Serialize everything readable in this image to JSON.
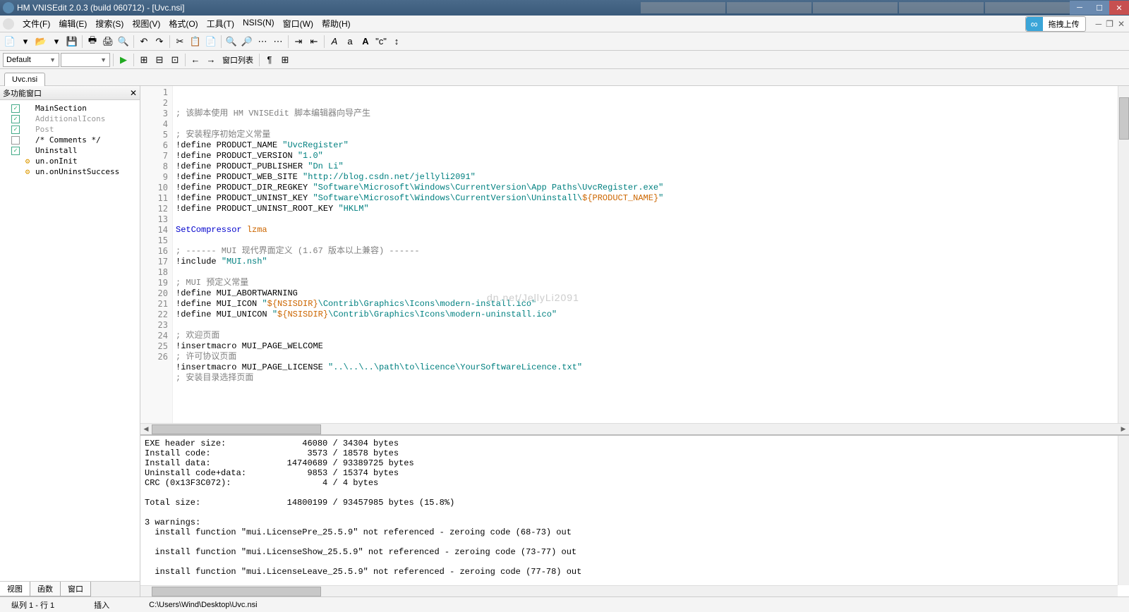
{
  "title": "HM VNISEdit 2.0.3 (build 060712) - [Uvc.nsi]",
  "menu": [
    "文件(F)",
    "编辑(E)",
    "搜索(S)",
    "视图(V)",
    "格式(O)",
    "工具(T)",
    "NSIS(N)",
    "窗口(W)",
    "帮助(H)"
  ],
  "upload_text": "拖拽上传",
  "combo1": "Default",
  "window_list_label": "窗口列表",
  "file_tab": "Uvc.nsi",
  "panel_title": "多功能窗口",
  "tree": [
    {
      "check": true,
      "icon": "□",
      "label": "MainSection",
      "gray": false
    },
    {
      "check": true,
      "icon": "□",
      "label": "AdditionalIcons",
      "gray": true
    },
    {
      "check": true,
      "icon": "□",
      "label": "Post",
      "gray": true
    },
    {
      "check": false,
      "icon": "□",
      "label": "/* Comments */",
      "gray": false
    },
    {
      "check": true,
      "icon": "□",
      "label": "Uninstall",
      "gray": false
    },
    {
      "check": false,
      "icon": "⚙",
      "label": "un.onInit",
      "gray": false
    },
    {
      "check": false,
      "icon": "⚙",
      "label": "un.onUninstSuccess",
      "gray": false
    }
  ],
  "bottom_tabs": [
    "视图",
    "函数",
    "窗口"
  ],
  "code_lines": [
    {
      "n": 1,
      "html": "<span class='kw-comment'>; 该脚本使用 HM VNISEdit 脚本编辑器向导产生</span>"
    },
    {
      "n": 2,
      "html": ""
    },
    {
      "n": 3,
      "html": "<span class='kw-comment'>; 安装程序初始定义常量</span>"
    },
    {
      "n": 4,
      "html": "<span class='kw-define'>!define</span> PRODUCT_NAME <span class='kw-string'>\"UvcRegister\"</span>"
    },
    {
      "n": 5,
      "html": "<span class='kw-define'>!define</span> PRODUCT_VERSION <span class='kw-string'>\"1.0\"</span>"
    },
    {
      "n": 6,
      "html": "<span class='kw-define'>!define</span> PRODUCT_PUBLISHER <span class='kw-string'>\"Dn Li\"</span>"
    },
    {
      "n": 7,
      "html": "<span class='kw-define'>!define</span> PRODUCT_WEB_SITE <span class='kw-string'>\"http://blog.csdn.net/jellyli2091\"</span>"
    },
    {
      "n": 8,
      "html": "<span class='kw-define'>!define</span> PRODUCT_DIR_REGKEY <span class='kw-string'>\"Software\\Microsoft\\Windows\\CurrentVersion\\App Paths\\UvcRegister.exe\"</span>"
    },
    {
      "n": 9,
      "html": "<span class='kw-define'>!define</span> PRODUCT_UNINST_KEY <span class='kw-string'>\"Software\\Microsoft\\Windows\\CurrentVersion\\Uninstall\\</span><span class='kw-var'>${PRODUCT_NAME}</span><span class='kw-string'>\"</span>"
    },
    {
      "n": 10,
      "html": "<span class='kw-define'>!define</span> PRODUCT_UNINST_ROOT_KEY <span class='kw-string'>\"HKLM\"</span>"
    },
    {
      "n": 11,
      "html": ""
    },
    {
      "n": 12,
      "html": "<span class='kw-cmd'>SetCompressor</span> <span class='kw-macro'>lzma</span>"
    },
    {
      "n": 13,
      "html": ""
    },
    {
      "n": 14,
      "html": "<span class='kw-comment'>; ------ MUI 现代界面定义 (1.67 版本以上兼容) ------</span>"
    },
    {
      "n": 15,
      "html": "<span class='kw-define'>!include</span> <span class='kw-string'>\"MUI.nsh\"</span>"
    },
    {
      "n": 16,
      "html": ""
    },
    {
      "n": 17,
      "html": "<span class='kw-comment'>; MUI 预定义常量</span>"
    },
    {
      "n": 18,
      "html": "<span class='kw-define'>!define</span> MUI_ABORTWARNING"
    },
    {
      "n": 19,
      "html": "<span class='kw-define'>!define</span> MUI_ICON <span class='kw-string'>\"</span><span class='kw-var'>${NSISDIR}</span><span class='kw-string'>\\Contrib\\Graphics\\Icons\\modern-install.ico\"</span>"
    },
    {
      "n": 20,
      "html": "<span class='kw-define'>!define</span> MUI_UNICON <span class='kw-string'>\"</span><span class='kw-var'>${NSISDIR}</span><span class='kw-string'>\\Contrib\\Graphics\\Icons\\modern-uninstall.ico\"</span>"
    },
    {
      "n": 21,
      "html": ""
    },
    {
      "n": 22,
      "html": "<span class='kw-comment'>; 欢迎页面</span>"
    },
    {
      "n": 23,
      "html": "<span class='kw-define'>!insertmacro</span> MUI_PAGE_WELCOME"
    },
    {
      "n": 24,
      "html": "<span class='kw-comment'>; 许可协议页面</span>"
    },
    {
      "n": 25,
      "html": "<span class='kw-define'>!insertmacro</span> MUI_PAGE_LICENSE <span class='kw-string'>\"..\\..\\..\\path\\to\\licence\\YourSoftwareLicence.txt\"</span>"
    },
    {
      "n": 26,
      "html": "<span class='kw-comment'>; 安装目录选择页面</span>"
    }
  ],
  "output_text": "EXE header size:               46080 / 34304 bytes\nInstall code:                   3573 / 18578 bytes\nInstall data:               14740689 / 93389725 bytes\nUninstall code+data:            9853 / 15374 bytes\nCRC (0x13F3C072):                  4 / 4 bytes\n\nTotal size:                 14800199 / 93457985 bytes (15.8%)\n\n3 warnings:\n  install function \"mui.LicensePre_25.5.9\" not referenced - zeroing code (68-73) out\n\n  install function \"mui.LicenseShow_25.5.9\" not referenced - zeroing code (73-77) out\n\n  install function \"mui.LicenseLeave_25.5.9\" not referenced - zeroing code (77-78) out",
  "status": {
    "pos": "纵列 1 - 行 1",
    "mode": "插入",
    "path": "C:\\Users\\Wind\\Desktop\\Uvc.nsi"
  },
  "watermark": "dn.net/JellyLi2091"
}
